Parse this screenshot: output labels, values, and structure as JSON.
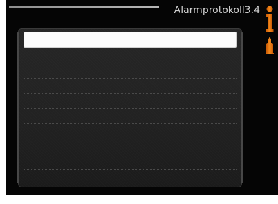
{
  "header": {
    "title": "Alarmprotokoll",
    "menu_number": "3.4"
  },
  "alarm_log": {
    "entries": [
      "",
      "",
      "",
      "",
      "",
      "",
      "",
      "",
      "",
      ""
    ]
  },
  "icons": {
    "help": "info-icon",
    "menu": "menu-icon"
  },
  "colors": {
    "accent": "#e8740f",
    "background": "#050505",
    "panel": "#242424"
  }
}
